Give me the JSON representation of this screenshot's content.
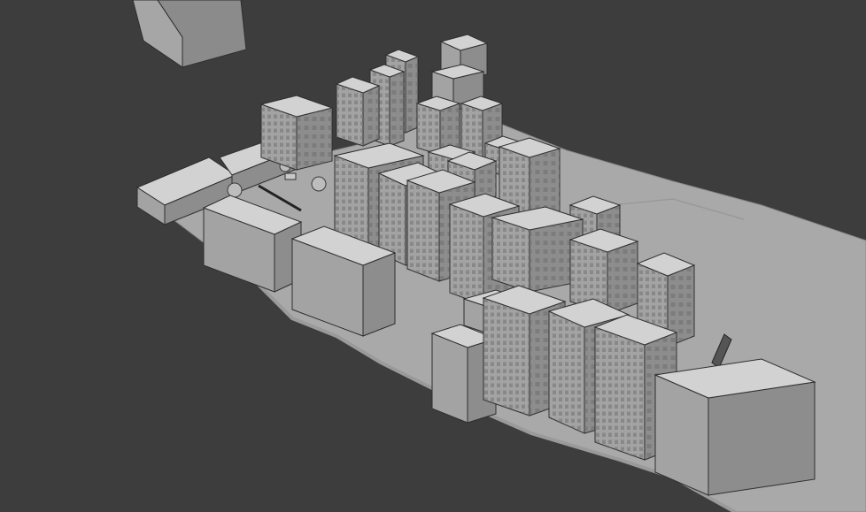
{
  "viewport": {
    "colors": {
      "background": "#3d3d3d",
      "ground": "#a9a9a9",
      "ground_edge": "#8c8c8c",
      "top_face": "#d2d2d2",
      "left_face": "#a3a3a3",
      "right_face": "#8d8d8d",
      "window_grid": "#6a6a6a",
      "outline": "#2e2e2e"
    }
  }
}
